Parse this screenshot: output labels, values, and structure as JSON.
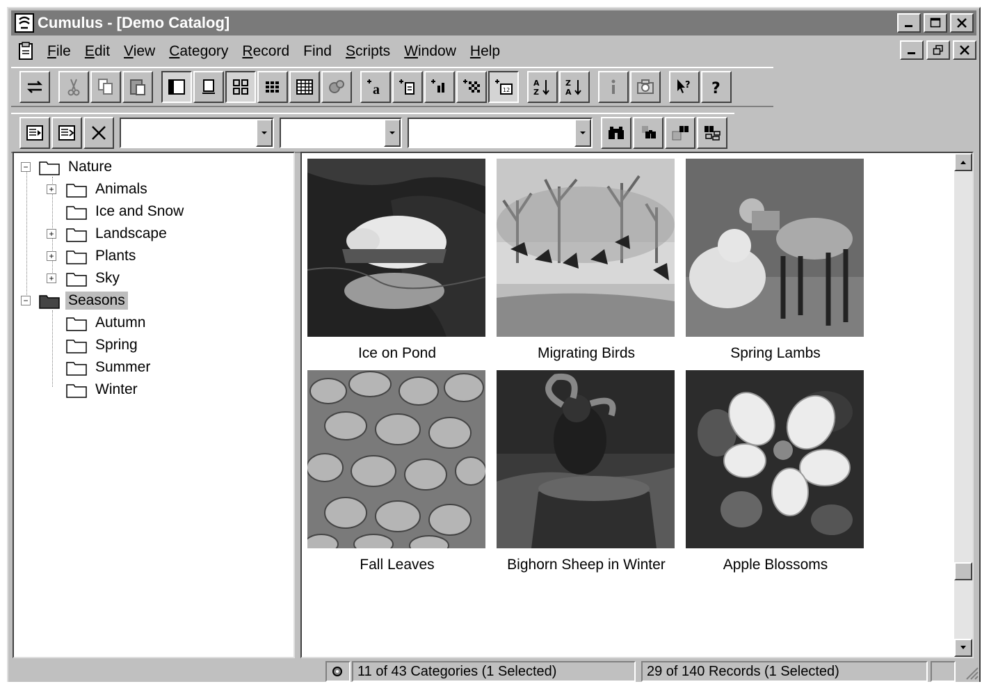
{
  "window": {
    "title": "Cumulus - [Demo Catalog]"
  },
  "menubar": {
    "items": [
      {
        "label": "File",
        "mnemonic": "F",
        "rest": "ile"
      },
      {
        "label": "Edit",
        "mnemonic": "E",
        "rest": "dit"
      },
      {
        "label": "View",
        "mnemonic": "V",
        "rest": "iew"
      },
      {
        "label": "Category",
        "mnemonic": "C",
        "rest": "ategory"
      },
      {
        "label": "Record",
        "mnemonic": "R",
        "rest": "ecord"
      },
      {
        "label": "Find",
        "mnemonic": "",
        "rest": "Find"
      },
      {
        "label": "Scripts",
        "mnemonic": "S",
        "rest": "cripts"
      },
      {
        "label": "Window",
        "mnemonic": "W",
        "rest": "indow"
      },
      {
        "label": "Help",
        "mnemonic": "H",
        "rest": "elp"
      }
    ]
  },
  "toolbar": {
    "combo1_value": "",
    "combo2_value": "",
    "combo3_value": ""
  },
  "tree": {
    "items": [
      {
        "label": "Nature",
        "level": 0,
        "expander": "minus",
        "selected": false
      },
      {
        "label": "Animals",
        "level": 1,
        "expander": "plus",
        "selected": false
      },
      {
        "label": "Ice and Snow",
        "level": 1,
        "expander": "none",
        "selected": false
      },
      {
        "label": "Landscape",
        "level": 1,
        "expander": "plus",
        "selected": false
      },
      {
        "label": "Plants",
        "level": 1,
        "expander": "plus",
        "selected": false
      },
      {
        "label": "Sky",
        "level": 1,
        "expander": "plus",
        "selected": false
      },
      {
        "label": "Seasons",
        "level": 0,
        "expander": "minus",
        "selected": true
      },
      {
        "label": "Autumn",
        "level": 1,
        "expander": "none",
        "selected": false
      },
      {
        "label": "Spring",
        "level": 1,
        "expander": "none",
        "selected": false
      },
      {
        "label": "Summer",
        "level": 1,
        "expander": "none",
        "selected": false
      },
      {
        "label": "Winter",
        "level": 1,
        "expander": "none",
        "selected": false
      }
    ]
  },
  "records": [
    {
      "caption": "Ice on Pond"
    },
    {
      "caption": "Migrating Birds"
    },
    {
      "caption": "Spring Lambs"
    },
    {
      "caption": "Fall Leaves"
    },
    {
      "caption": "Bighorn Sheep in Winter"
    },
    {
      "caption": "Apple Blossoms"
    }
  ],
  "status": {
    "categories": "11 of 43 Categories (1 Selected)",
    "records": "29 of 140 Records (1 Selected)"
  },
  "colors": {
    "chrome": "#c0c0c0",
    "title_bar": "#7a7a7a",
    "selection": "#bdbdbd"
  }
}
